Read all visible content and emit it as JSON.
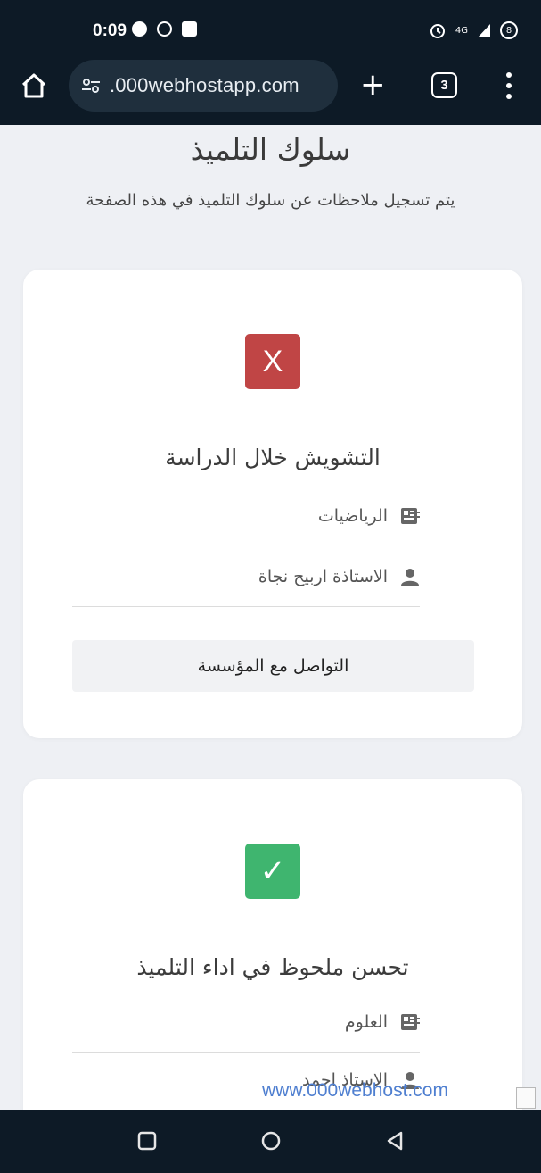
{
  "status": {
    "time": "0:09",
    "network": "4G",
    "battery": "8"
  },
  "browser": {
    "url": ".000webhostapp.com",
    "tab_count": "3"
  },
  "page": {
    "title": "سلوك التلميذ",
    "subtitle": "يتم تسجيل ملاحظات عن سلوك التلميذ في هذه الصفحة"
  },
  "cards": [
    {
      "badge": "X",
      "badge_type": "negative",
      "badge_color": "#c04545",
      "title": "التشويش خلال الدراسة",
      "subject": "الرياضيات",
      "teacher": "الاستاذة اربيح نجاة",
      "button": "التواصل مع المؤسسة"
    },
    {
      "badge": "✓",
      "badge_type": "positive",
      "badge_color": "#3fb56f",
      "title": "تحسن ملحوظ في اداء التلميذ",
      "subject": "العلوم",
      "teacher": "الاستاذ احمد"
    }
  ],
  "overlay": {
    "link_text": "www.000webhost.com"
  }
}
